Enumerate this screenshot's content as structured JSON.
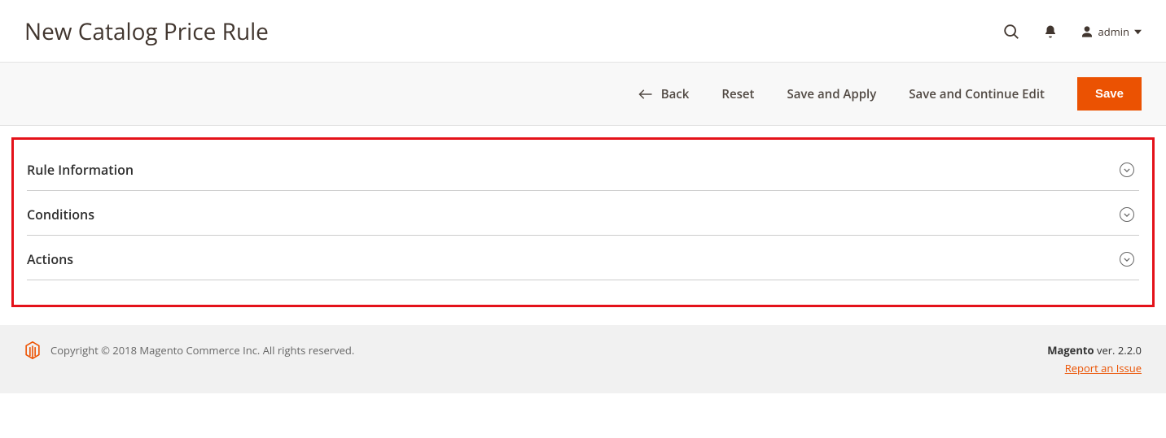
{
  "header": {
    "title": "New Catalog Price Rule",
    "user_label": "admin"
  },
  "toolbar": {
    "back_label": "Back",
    "reset_label": "Reset",
    "save_apply_label": "Save and Apply",
    "save_continue_label": "Save and Continue Edit",
    "save_label": "Save"
  },
  "sections": [
    {
      "title": "Rule Information"
    },
    {
      "title": "Conditions"
    },
    {
      "title": "Actions"
    }
  ],
  "footer": {
    "copyright": "Copyright © 2018 Magento Commerce Inc. All rights reserved.",
    "product": "Magento",
    "version_prefix": " ver. ",
    "version": "2.2.0",
    "report_link": "Report an Issue"
  }
}
